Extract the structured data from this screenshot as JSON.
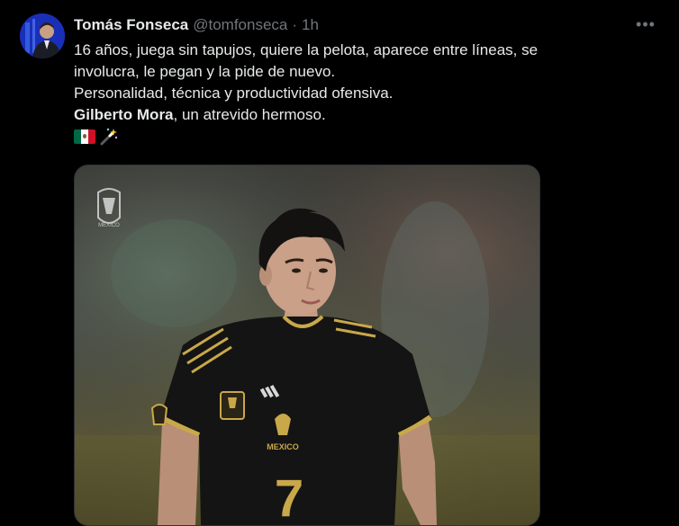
{
  "author": {
    "name": "Tomás Fonseca",
    "handle": "@tomfonseca",
    "separator": "·",
    "time": "1h"
  },
  "more_menu": "•••",
  "tweet": {
    "line1": "16 años, juega sin tapujos, quiere la pelota, aparece entre líneas, se",
    "line2": "involucra, le pegan y la pide de nuevo.",
    "line3": "Personalidad, técnica y productividad ofensiva.",
    "line4_bold": "Gilberto Mora",
    "line4_rest": ", un atrevido hermoso.",
    "emojis": [
      "flag-mexico-icon",
      "magic-wand-icon"
    ]
  },
  "media": {
    "badge_text": "MÉXICO",
    "chest_text": "MEXICO",
    "shirt_number": "7",
    "jersey_color": "#111111",
    "trim_color": "#c9a84a"
  }
}
